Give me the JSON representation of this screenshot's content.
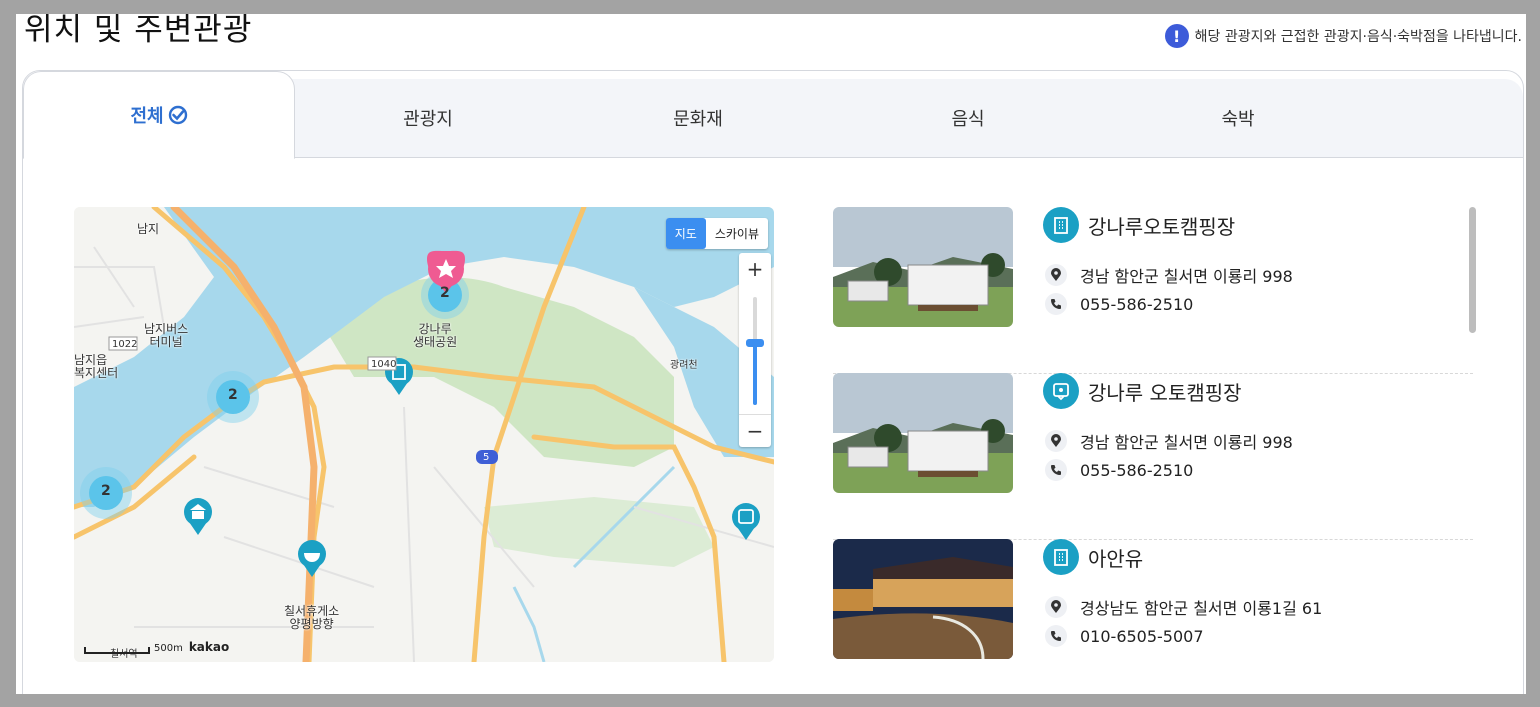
{
  "section": {
    "title": "위치 및 주변관광",
    "notice": "해당 관광지와 근접한 관광지·음식·숙박점을 나타냅니다."
  },
  "tabs": [
    {
      "label": "전체",
      "active": true
    },
    {
      "label": "관광지"
    },
    {
      "label": "문화재"
    },
    {
      "label": "음식"
    },
    {
      "label": "숙박"
    }
  ],
  "map": {
    "type_buttons": [
      "지도",
      "스카이뷰"
    ],
    "zoom_in": "+",
    "zoom_out": "−",
    "zoom_level_fraction": 0.45,
    "labels": {
      "namji": "남지",
      "bus_terminal": "남지버스\n터미널",
      "welfare": "남지읍\n복지센터",
      "park": "강나루\n생태공원",
      "rest_area": "칠서휴게소\n양평방향",
      "gwangryeo": "광려천",
      "route_1022": "1022",
      "route_1040": "1040",
      "route_5": "5",
      "cluster_a": "2",
      "cluster_b": "2",
      "cluster_c": "2",
      "scale": "500m",
      "brand": "kakao",
      "station": "칠서역"
    }
  },
  "items": [
    {
      "title": "강나루오토캠핑장",
      "address": "경남 함안군 칠서면 이룡리 998",
      "phone": "055-586-2510",
      "icon": "building-icon"
    },
    {
      "title": "강나루 오토캠핑장",
      "address": "경남 함안군 칠서면 이룡리 998",
      "phone": "055-586-2510",
      "icon": "place-pin-icon"
    },
    {
      "title": "아안유",
      "address": "경상남도 함안군 칠서면 이룡1길 61",
      "phone": "010-6505-5007",
      "icon": "building-icon"
    }
  ],
  "colors": {
    "accent": "#1ba0c4",
    "active_tab": "#2e6fd0",
    "river": "#a7d8ec",
    "park": "#cfe6c4",
    "road_major": "#f7c46b",
    "marker_pink": "#ef5b92"
  }
}
